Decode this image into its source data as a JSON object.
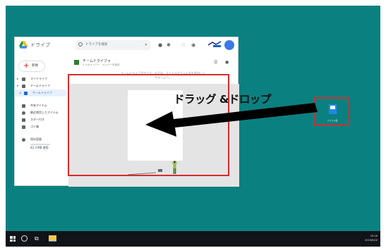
{
  "drive": {
    "app_title": "ドライブ",
    "search_placeholder": "ドライブを検索",
    "new_button": "新規",
    "nav": [
      {
        "label": "マイドライブ",
        "icon": "my-drive-icon"
      },
      {
        "label": "チームドライブ",
        "icon": "team-drive-icon"
      },
      {
        "label": "チームドライブ",
        "icon": "team-drive-icon",
        "active": true
      },
      {
        "label": "共有アイテム",
        "icon": "shared-icon"
      },
      {
        "label": "最近使用したアイテム",
        "icon": "clock-icon"
      },
      {
        "label": "スター付き",
        "icon": "star-icon"
      },
      {
        "label": "ゴミ箱",
        "icon": "trash-icon"
      },
      {
        "label": "保存容量",
        "icon": "cloud-icon"
      }
    ],
    "storage_text": "42.3 MB 使用",
    "breadcrumb_title": "チームドライブ ▾",
    "breadcrumb_sub": "3 人のメンバー・メンバーを追加",
    "empty_message": "チームドライブが空です。まずは、ファイルやフォルダを追加してみましょう。"
  },
  "overlay": {
    "drag_label": "ドラッグ &ドロップ",
    "highlight_color": "#d22d2d"
  },
  "desktop": {
    "background_color": "#0b8080",
    "file_name": "ファイル名"
  },
  "taskbar": {
    "time": "15:16",
    "date": "2019/02/2"
  }
}
